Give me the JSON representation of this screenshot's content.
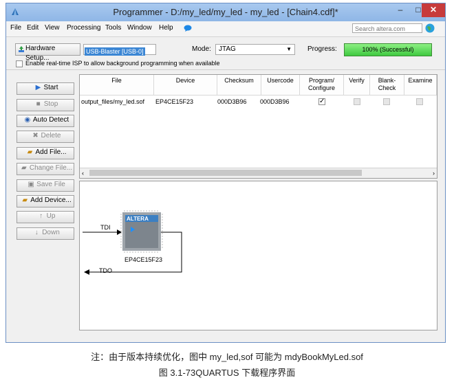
{
  "window": {
    "title": "Programmer - D:/my_led/my_led - my_led - [Chain4.cdf]*",
    "min_symbol": "–",
    "max_symbol": "□",
    "close_symbol": "✕"
  },
  "menu": {
    "items": [
      "File",
      "Edit",
      "View",
      "Processing",
      "Tools",
      "Window",
      "Help"
    ],
    "search_placeholder": "Search altera.com"
  },
  "toolbar": {
    "hardware_setup_label": "Hardware Setup...",
    "hardware_value": "USB-Blaster [USB-0]",
    "mode_label": "Mode:",
    "mode_value": "JTAG",
    "progress_label": "Progress:",
    "progress_text": "100% (Successful)",
    "progress_percent": 100,
    "isp_checkbox_label": "Enable real-time ISP to allow background programming when available"
  },
  "sidebar": {
    "buttons": [
      {
        "label": "Start",
        "enabled": true
      },
      {
        "label": "Stop",
        "enabled": false
      },
      {
        "label": "Auto Detect",
        "enabled": true
      },
      {
        "label": "Delete",
        "enabled": false
      },
      {
        "label": "Add File...",
        "enabled": true
      },
      {
        "label": "Change File...",
        "enabled": false
      },
      {
        "label": "Save File",
        "enabled": false
      },
      {
        "label": "Add Device...",
        "enabled": true
      },
      {
        "label": "Up",
        "enabled": false
      },
      {
        "label": "Down",
        "enabled": false
      }
    ]
  },
  "table": {
    "headers": [
      "File",
      "Device",
      "Checksum",
      "Usercode",
      "Program/\nConfigure",
      "Verify",
      "Blank-\nCheck",
      "Examine"
    ],
    "row": {
      "file": "output_files/my_led.sof",
      "device": "EP4CE15F23",
      "checksum": "000D3B96",
      "usercode": "000D3B96",
      "program_configure": true,
      "verify": false,
      "blank_check": false,
      "examine": false
    }
  },
  "chain": {
    "tdi_label": "TDI",
    "tdo_label": "TDO",
    "chip_brand": "ALTERA",
    "chip_name": "EP4CE15F23"
  },
  "caption": {
    "note": "注：由于版本持续优化，图中 my_led,sof 可能为 mdyBookMyLed.sof",
    "figure": "图 3.1-73QUARTUS 下载程序界面"
  },
  "colors": {
    "title_bar": "#a9c9ef",
    "close_button": "#c73b3b",
    "progress_fill": "#3fc940",
    "selection": "#3b86d4"
  }
}
